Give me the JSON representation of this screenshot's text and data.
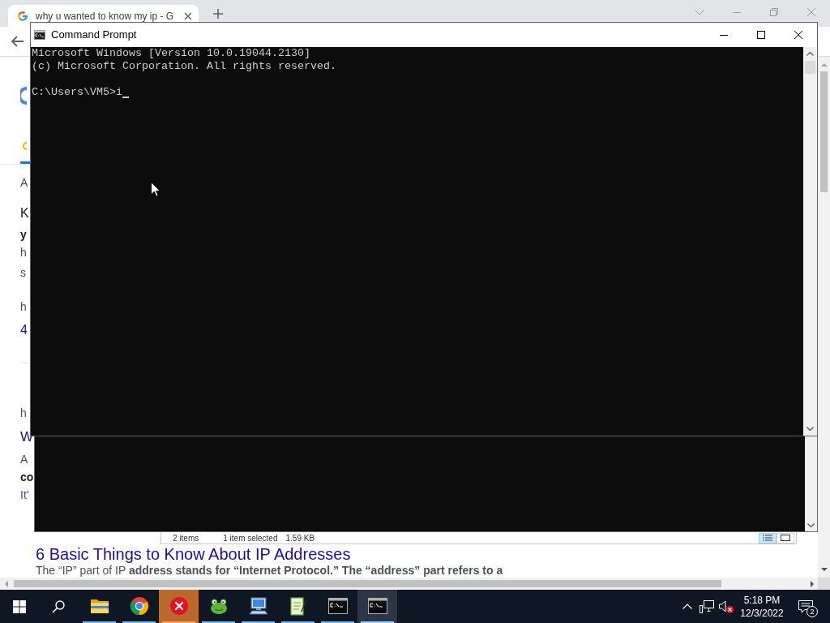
{
  "browser": {
    "tab": {
      "title": "why u wanted to know my ip - G",
      "selected": true
    },
    "page": {
      "fragments": [
        {
          "kind": "plain",
          "text": "A"
        },
        {
          "kind": "title",
          "text": "K"
        },
        {
          "kind": "bold",
          "text": "y"
        },
        {
          "kind": "plain",
          "text": "h"
        },
        {
          "kind": "plain",
          "text": "s"
        },
        {
          "kind": "plain",
          "text": "h"
        },
        {
          "kind": "link",
          "text": "4"
        },
        {
          "kind": "plain",
          "text": "h"
        },
        {
          "kind": "heading",
          "text": "W"
        },
        {
          "kind": "plain",
          "text": "A"
        },
        {
          "kind": "bold",
          "text": "co"
        },
        {
          "kind": "muted-link",
          "text": "It’"
        }
      ],
      "result": {
        "title": "6 Basic Things to Know About IP Addresses",
        "snippet": "The “IP” part of IP **address stands for “Internet Protocol.” The “address” part refers to a**"
      }
    }
  },
  "command_prompt": {
    "title": "Command Prompt",
    "output": [
      "Microsoft Windows [Version 10.0.19044.2130]",
      "(c) Microsoft Corporation. All rights reserved."
    ],
    "prompt": "C:\\Users\\VM5>",
    "input": "i"
  },
  "explorer_status_bar": {
    "item_count": "2 items",
    "selection": "1 item selected",
    "size": "1.59 KB",
    "view_buttons": [
      {
        "kind": "details",
        "selected": true
      },
      {
        "kind": "large-icons",
        "selected": false
      }
    ]
  },
  "taskbar": {
    "apps": [
      {
        "kind": "folder",
        "running": true,
        "selected": false,
        "flashing": false
      },
      {
        "kind": "color-wheel",
        "running": true,
        "selected": false,
        "flashing": false
      },
      {
        "kind": "error",
        "running": true,
        "selected": false,
        "flashing": true
      },
      {
        "kind": "frog",
        "running": true,
        "selected": false,
        "flashing": false
      },
      {
        "kind": "computer",
        "running": true,
        "selected": false,
        "flashing": false
      },
      {
        "kind": "notepad",
        "running": true,
        "selected": false,
        "flashing": false
      },
      {
        "kind": "console",
        "running": true,
        "selected": false,
        "flashing": false
      },
      {
        "kind": "console",
        "running": true,
        "selected": true,
        "flashing": false
      }
    ],
    "tray": {
      "volume_muted": true,
      "time": "5:18 PM",
      "date": "12/3/2022",
      "notification_count": "2"
    }
  }
}
